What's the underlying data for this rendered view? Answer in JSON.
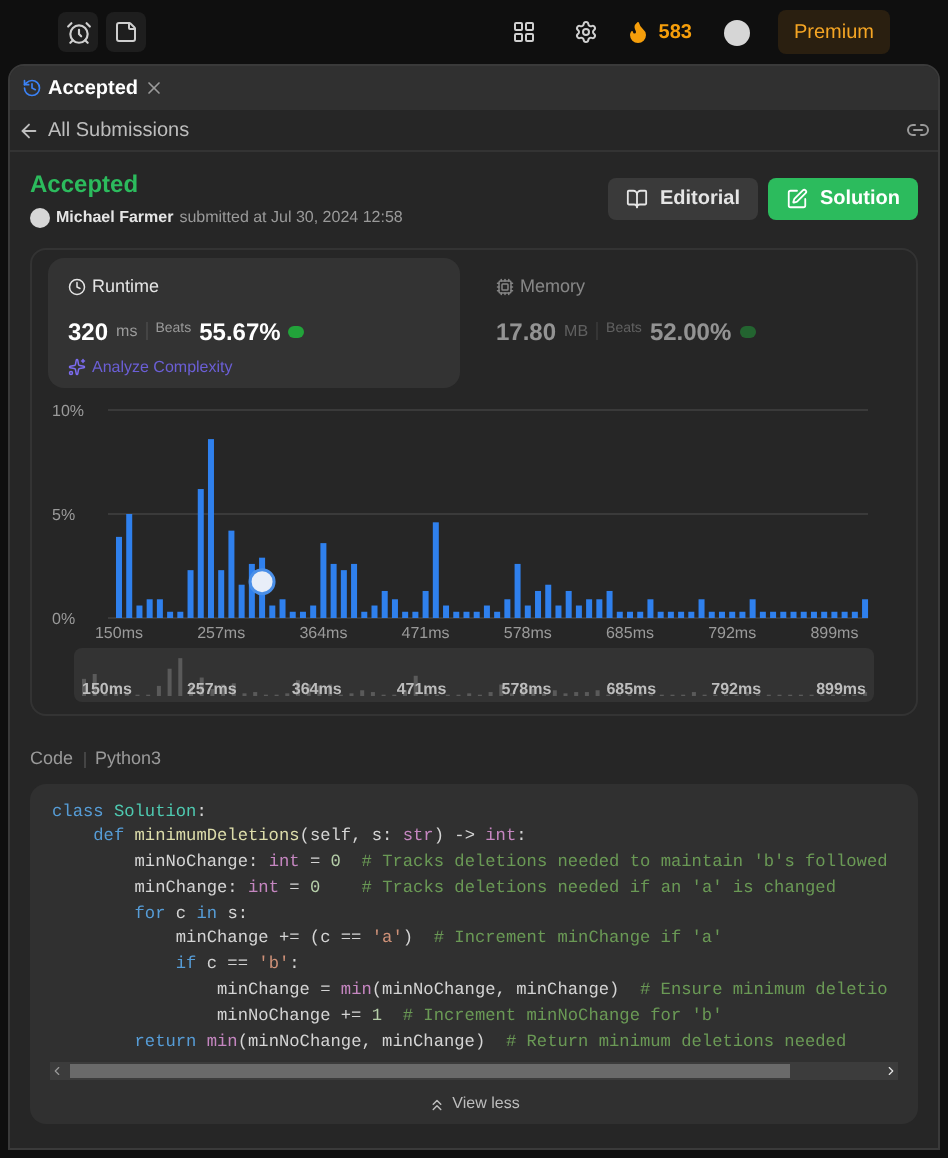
{
  "topbar": {
    "streak": "583",
    "premium": "Premium"
  },
  "tab": {
    "label": "Accepted"
  },
  "back": {
    "label": "All Submissions"
  },
  "result": {
    "status": "Accepted",
    "author": "Michael Farmer",
    "submitted": "submitted at Jul 30, 2024 12:58",
    "buttons": [
      {
        "label": "Editorial",
        "kind": "editorial"
      },
      {
        "label": "Solution",
        "kind": "solution"
      }
    ]
  },
  "metrics": [
    {
      "kind": "runtime",
      "title": "Runtime",
      "value": "320",
      "unit": "ms",
      "beats_label": "Beats",
      "beats": "55.67%",
      "selected": true,
      "action": "Analyze Complexity"
    },
    {
      "kind": "memory",
      "title": "Memory",
      "value": "17.80",
      "unit": "MB",
      "beats_label": "Beats",
      "beats": "52.00%",
      "selected": false
    }
  ],
  "chart_data": {
    "type": "bar",
    "ylim": [
      0,
      10
    ],
    "yticks": [
      {
        "value": 0,
        "label": "0%"
      },
      {
        "value": 5,
        "label": "5%"
      },
      {
        "value": 10,
        "label": "10%"
      }
    ],
    "categories": [
      "150ms",
      null,
      null,
      null,
      null,
      null,
      null,
      null,
      null,
      null,
      "257ms",
      null,
      null,
      null,
      null,
      null,
      null,
      null,
      null,
      null,
      "364ms",
      null,
      null,
      null,
      null,
      null,
      null,
      null,
      null,
      null,
      "471ms",
      null,
      null,
      null,
      null,
      null,
      null,
      null,
      null,
      null,
      "578ms",
      null,
      null,
      null,
      null,
      null,
      null,
      null,
      null,
      null,
      "685ms",
      null,
      null,
      null,
      null,
      null,
      null,
      null,
      null,
      null,
      "792ms",
      null,
      null,
      null,
      null,
      null,
      null,
      null,
      null,
      null,
      "899ms",
      null,
      null,
      null
    ],
    "series": [
      {
        "color": "#2f80ed",
        "values": [
          3.9,
          5.0,
          0.6,
          0.9,
          0.9,
          0.3,
          0.3,
          2.3,
          6.2,
          8.6,
          2.3,
          4.2,
          1.6,
          2.6,
          2.9,
          0.6,
          0.9,
          0.3,
          0.3,
          0.6,
          3.6,
          2.6,
          2.3,
          2.6,
          0.3,
          0.6,
          1.3,
          0.9,
          0.3,
          0.3,
          1.3,
          4.6,
          0.6,
          0.3,
          0.3,
          0.3,
          0.6,
          0.3,
          0.9,
          2.6,
          0.6,
          1.3,
          1.6,
          0.6,
          1.3,
          0.6,
          0.9,
          0.9,
          1.3,
          0.3,
          0.3,
          0.3,
          0.9,
          0.3,
          0.3,
          0.3,
          0.3,
          0.9,
          0.3,
          0.3,
          0.3,
          0.3,
          0.9,
          0.3,
          0.3,
          0.3,
          0.3,
          0.3,
          0.3,
          0.3,
          0.3,
          0.3,
          0.3,
          0.9
        ]
      }
    ]
  },
  "brush": {
    "labels": [
      "150ms",
      "257ms",
      "364ms",
      "471ms",
      "578ms",
      "685ms",
      "792ms",
      "899ms"
    ]
  },
  "code": {
    "label": "Code",
    "language": "Python3",
    "lines": [
      [
        {
          "kind": "keyword",
          "text": "class "
        },
        {
          "kind": "class",
          "text": "Solution"
        },
        {
          "kind": "plain",
          "text": ":"
        }
      ],
      [
        {
          "kind": "keyword",
          "text": "    def "
        },
        {
          "kind": "func",
          "text": "minimumDeletions"
        },
        {
          "kind": "plain",
          "text": "(self, s: "
        },
        {
          "kind": "type",
          "text": "str"
        },
        {
          "kind": "plain",
          "text": ") -> "
        },
        {
          "kind": "type",
          "text": "int"
        },
        {
          "kind": "plain",
          "text": ":"
        }
      ],
      [
        {
          "kind": "plain",
          "text": "        minNoChange: "
        },
        {
          "kind": "type",
          "text": "int"
        },
        {
          "kind": "plain",
          "text": " = "
        },
        {
          "kind": "number",
          "text": "0"
        },
        {
          "kind": "comment",
          "text": "  # Tracks deletions needed to maintain 'b's followed"
        }
      ],
      [
        {
          "kind": "plain",
          "text": "        minChange: "
        },
        {
          "kind": "type",
          "text": "int"
        },
        {
          "kind": "plain",
          "text": " = "
        },
        {
          "kind": "number",
          "text": "0"
        },
        {
          "kind": "comment",
          "text": "    # Tracks deletions needed if an 'a' is changed"
        }
      ],
      [
        {
          "kind": "keyword",
          "text": "        for"
        },
        {
          "kind": "plain",
          "text": " c "
        },
        {
          "kind": "keyword",
          "text": "in"
        },
        {
          "kind": "plain",
          "text": " s:"
        }
      ],
      [
        {
          "kind": "plain",
          "text": "            minChange += (c == "
        },
        {
          "kind": "string",
          "text": "'a'"
        },
        {
          "kind": "plain",
          "text": ")"
        },
        {
          "kind": "comment",
          "text": "  # Increment minChange if 'a'"
        }
      ],
      [
        {
          "kind": "keyword",
          "text": "            if"
        },
        {
          "kind": "plain",
          "text": " c == "
        },
        {
          "kind": "string",
          "text": "'b'"
        },
        {
          "kind": "plain",
          "text": ":"
        }
      ],
      [
        {
          "kind": "plain",
          "text": "                minChange = "
        },
        {
          "kind": "type",
          "text": "min"
        },
        {
          "kind": "plain",
          "text": "(minNoChange, minChange)"
        },
        {
          "kind": "comment",
          "text": "  # Ensure minimum deletio"
        }
      ],
      [
        {
          "kind": "plain",
          "text": "                minNoChange += "
        },
        {
          "kind": "number",
          "text": "1"
        },
        {
          "kind": "comment",
          "text": "  # Increment minNoChange for 'b'"
        }
      ],
      [
        {
          "kind": "keyword",
          "text": "        return "
        },
        {
          "kind": "type",
          "text": "min"
        },
        {
          "kind": "plain",
          "text": "(minNoChange, minChange)"
        },
        {
          "kind": "comment",
          "text": "  # Return minimum deletions needed"
        }
      ]
    ],
    "toggle": "View less"
  }
}
